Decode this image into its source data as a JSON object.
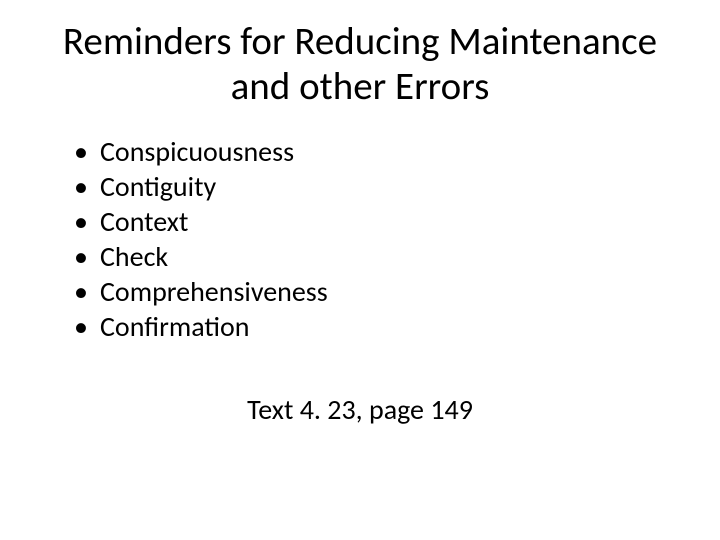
{
  "title": "Reminders for Reducing Maintenance and other Errors",
  "bullets": [
    "Conspicuousness",
    "Contiguity",
    "Context",
    "Check",
    "Comprehensiveness",
    "Confirmation"
  ],
  "reference": "Text 4. 23, page 149"
}
